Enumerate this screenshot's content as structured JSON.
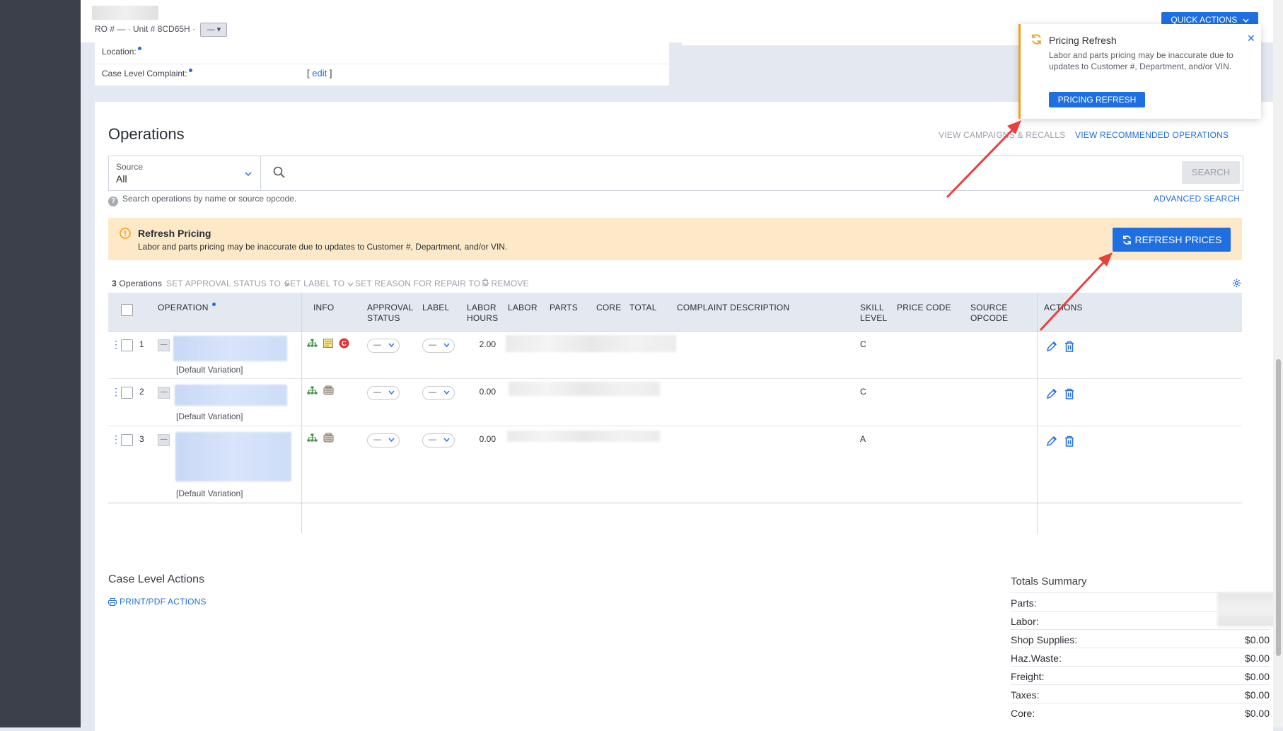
{
  "header": {
    "ro_line": "RO # — · Unit # 8CD65H ·",
    "ro_dropdown": "—",
    "quick_actions": "QUICK ACTIONS"
  },
  "case": {
    "location_label": "Location:",
    "complaint_label": "Case Level Complaint:",
    "edit_open": "[",
    "edit_link": "edit",
    "edit_close": "]"
  },
  "operations": {
    "title": "Operations",
    "view_campaigns": "VIEW CAMPAIGNS & RECALLS",
    "view_recommended": "VIEW RECOMMENDED OPERATIONS",
    "source_label": "Source",
    "source_value": "All",
    "search_button": "SEARCH",
    "search_hint": "Search operations by name or source opcode.",
    "advanced_search": "ADVANCED SEARCH"
  },
  "banner": {
    "title": "Refresh Pricing",
    "text": "Labor and parts pricing may be inaccurate due to updates to Customer #, Department, and/or VIN.",
    "button": "REFRESH PRICES"
  },
  "toolbar": {
    "count_num": "3",
    "count_label": "Operations",
    "set_approval": "SET APPROVAL STATUS TO",
    "set_label": "SET LABEL TO",
    "set_reason": "SET REASON FOR REPAIR TO",
    "remove": "REMOVE"
  },
  "table": {
    "headers": {
      "operation": "OPERATION",
      "info": "INFO",
      "approval_1": "APPROVAL",
      "approval_2": "STATUS",
      "label": "LABEL",
      "labor_hours_1": "LABOR",
      "labor_hours_2": "HOURS",
      "labor": "LABOR",
      "parts": "PARTS",
      "core": "CORE",
      "total": "TOTAL",
      "complaint": "COMPLAINT DESCRIPTION",
      "skill_1": "SKILL",
      "skill_2": "LEVEL",
      "price_code": "PRICE CODE",
      "source_1": "SOURCE",
      "source_2": "OPCODE",
      "actions": "ACTIONS"
    },
    "rows": [
      {
        "num": "1",
        "variation": "[Default Variation]",
        "approval": "—",
        "label": "—",
        "hours": "2.00",
        "skill": "C"
      },
      {
        "num": "2",
        "variation": "[Default Variation]",
        "approval": "—",
        "label": "—",
        "hours": "0.00",
        "skill": "C"
      },
      {
        "num": "3",
        "variation": "[Default Variation]",
        "approval": "—",
        "label": "—",
        "hours": "0.00",
        "skill": "A"
      }
    ]
  },
  "case_actions": {
    "title": "Case Level Actions",
    "print": "PRINT/PDF ACTIONS"
  },
  "totals": {
    "title": "Totals Summary",
    "rows": [
      {
        "label": "Parts:",
        "value": ""
      },
      {
        "label": "Labor:",
        "value": ""
      },
      {
        "label": "Shop Supplies:",
        "value": "$0.00"
      },
      {
        "label": "Haz.Waste:",
        "value": "$0.00"
      },
      {
        "label": "Freight:",
        "value": "$0.00"
      },
      {
        "label": "Taxes:",
        "value": "$0.00"
      },
      {
        "label": "Core:",
        "value": "$0.00"
      }
    ]
  },
  "popup": {
    "title": "Pricing Refresh",
    "close": "✕",
    "text": "Labor and parts pricing may be inaccurate due to updates to Customer #, Department, and/or VIN.",
    "button": "PRICING REFRESH"
  },
  "colors": {
    "accent": "#1f6fe0",
    "banner_bg": "#fde9c8",
    "warning": "#f0a020",
    "arrow": "#e8413c",
    "sidebar": "#3b404a"
  },
  "icons": [
    "search-icon",
    "chevron-down-icon",
    "warning-icon",
    "refresh-icon",
    "gear-icon",
    "trash-icon",
    "edit-pencil-icon",
    "hierarchy-icon",
    "note-icon",
    "campaign-c-icon",
    "tools-icon",
    "printer-icon",
    "close-icon"
  ]
}
